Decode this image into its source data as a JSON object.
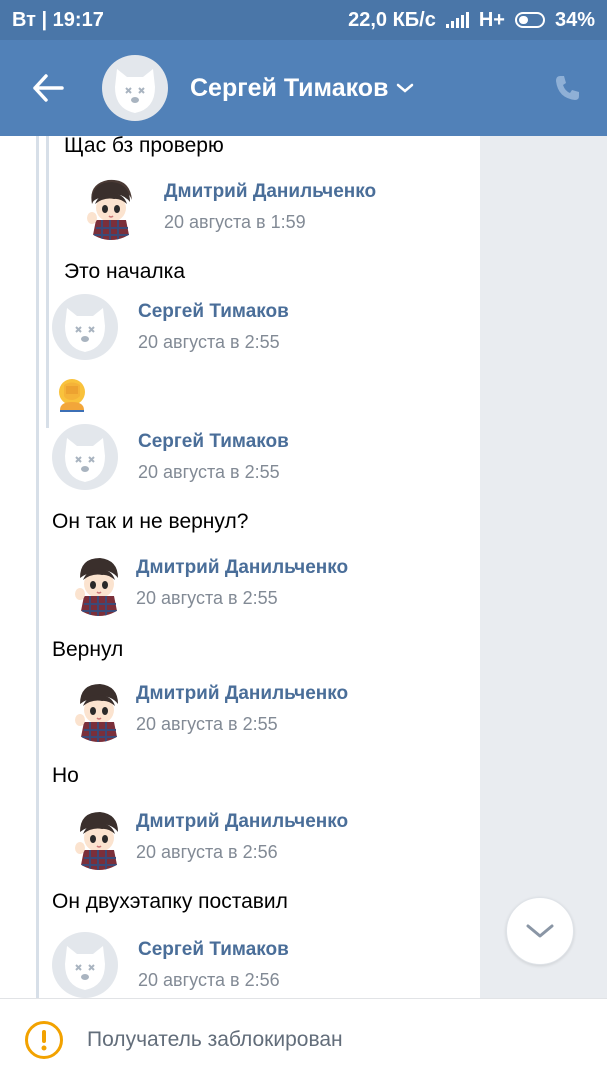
{
  "status_bar": {
    "day_time": "Вт | 19:17",
    "speed": "22,0 КБ/с",
    "network": "H+",
    "battery": "34%"
  },
  "header": {
    "title": "Сергей Тимаков"
  },
  "messages": [
    {
      "text": "Щас бз проверю"
    },
    {
      "author": "Дмитрий Данильченко",
      "date": "20 августа в 1:59",
      "avatar": "anime-avatar"
    },
    {
      "text": "Это началка"
    },
    {
      "author": "Сергей Тимаков",
      "date": "20 августа в 2:55",
      "avatar": "dog-avatar"
    },
    {
      "emoji": "face-palm"
    },
    {
      "author": "Сергей Тимаков",
      "date": "20 августа в 2:55",
      "avatar": "dog-avatar"
    },
    {
      "text": "Он так и не вернул?"
    },
    {
      "author": "Дмитрий Данильченко",
      "date": "20 августа в 2:55",
      "avatar": "anime-avatar"
    },
    {
      "text": "Вернул"
    },
    {
      "author": "Дмитрий Данильченко",
      "date": "20 августа в 2:55",
      "avatar": "anime-avatar"
    },
    {
      "text": "Но"
    },
    {
      "author": "Дмитрий Данильченко",
      "date": "20 августа в 2:56",
      "avatar": "anime-avatar"
    },
    {
      "text": "Он двухэтапку поставил"
    },
    {
      "author": "Сергей Тимаков",
      "date": "20 августа в 2:56",
      "avatar": "dog-avatar"
    }
  ],
  "bottom_bar": {
    "notice": "Получатель заблокирован"
  },
  "colors": {
    "header": "#5181b8",
    "status_bar": "#4a76a8",
    "author_name": "#4a6e99",
    "warning": "#f2a200"
  }
}
